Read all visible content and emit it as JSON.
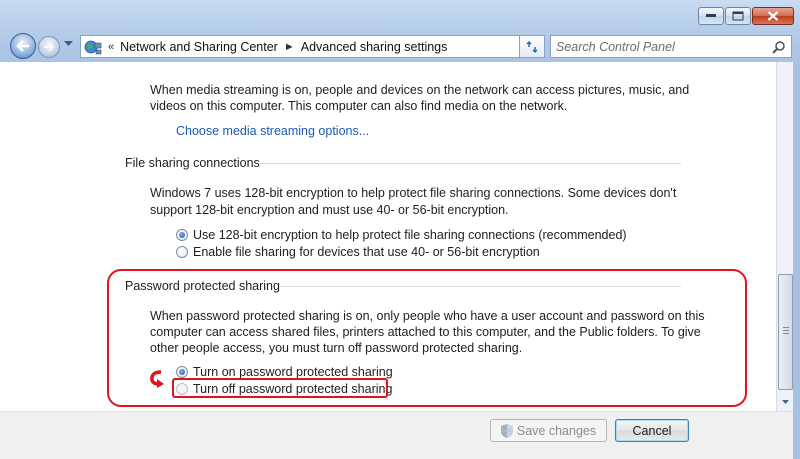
{
  "window": {
    "caption_buttons": [
      "minimize-icon",
      "maximize-icon",
      "close-icon"
    ]
  },
  "navbar": {
    "breadcrumbs": [
      "Network and Sharing Center",
      "Advanced sharing settings"
    ],
    "overflow_chevron": "«",
    "separator": "►",
    "search_placeholder": "Search Control Panel"
  },
  "media": {
    "description_line1": "When media streaming is on, people and devices on the network can access pictures, music, and",
    "description_line2": "videos on this computer. This computer can also find media on the network.",
    "link": "Choose media streaming options..."
  },
  "file_sharing": {
    "title": "File sharing connections",
    "description_line1": "Windows 7 uses 128-bit encryption to help protect file sharing connections. Some devices don't",
    "description_line2": "support 128-bit encryption and must use 40- or 56-bit encryption.",
    "options": [
      {
        "label": "Use 128-bit encryption to help protect file sharing connections (recommended)",
        "checked": true
      },
      {
        "label": "Enable file sharing for devices that use 40- or 56-bit encryption",
        "checked": false
      }
    ]
  },
  "password_sharing": {
    "title": "Password protected sharing",
    "description_line1": "When password protected sharing is on, only people who have a user account and password on this",
    "description_line2": "computer can access shared files, printers attached to this computer, and the Public folders. To give",
    "description_line3": "other people access, you must turn off password protected sharing.",
    "options": [
      {
        "label": "Turn on password protected sharing",
        "checked": true
      },
      {
        "label": "Turn off password protected sharing",
        "checked": false
      }
    ],
    "highlight_color": "#e0141e"
  },
  "footer": {
    "save_label": "Save changes",
    "cancel_label": "Cancel"
  }
}
